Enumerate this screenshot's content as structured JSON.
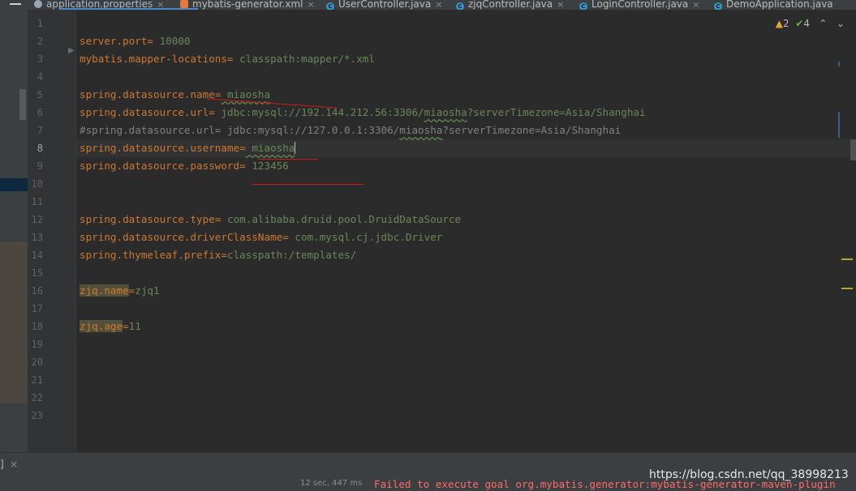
{
  "tabs": [
    {
      "label": "application.properties",
      "icon": "properties-file-icon",
      "active": true
    },
    {
      "label": "mybatis-generator.xml",
      "icon": "xml-file-icon"
    },
    {
      "label": "UserController.java",
      "icon": "java-class-icon"
    },
    {
      "label": "zjqController.java",
      "icon": "java-class-icon"
    },
    {
      "label": "LoginController.java",
      "icon": "java-class-icon"
    },
    {
      "label": "DemoApplication.java",
      "icon": "spring-app-icon"
    }
  ],
  "tab_close_glyph": "×",
  "inspection": {
    "warnings": "2",
    "ok": "4",
    "up": "^",
    "down": "v"
  },
  "line_numbers": [
    "1",
    "2",
    "3",
    "4",
    "5",
    "6",
    "7",
    "8",
    "9",
    "10",
    "11",
    "12",
    "13",
    "14",
    "15",
    "16",
    "17",
    "18",
    "19",
    "20",
    "21",
    "22",
    "23"
  ],
  "current_line": "8",
  "code": {
    "l2": {
      "key": "server.port",
      "eq": "=",
      "val": " 10000"
    },
    "l3": {
      "key": "mybatis.mapper-locations",
      "eq": "=",
      "val": " classpath:mapper/*.xml"
    },
    "l5": {
      "key": "spring.datasource.name",
      "eq": "=",
      "val": " miaosha"
    },
    "l6": {
      "key": "spring.datasource.url",
      "eq": "=",
      "val1": " jdbc:mysql://192.144.212.56:3306/",
      "typo": "miaosha",
      "val2": "?serverTimezone=Asia/Shanghai"
    },
    "l7": {
      "comment1": "#spring.datasource.url= jdbc:mysql://127.0.0.1:3306/",
      "typo": "miaosha",
      "comment2": "?serverTimezone=Asia/Shanghai"
    },
    "l8": {
      "key": "spring.datasource.username",
      "eq": "=",
      "val": " miaosha"
    },
    "l9": {
      "key": "spring.datasource.password",
      "eq": "=",
      "val": " 123456"
    },
    "l12": {
      "key": "spring.datasource.type",
      "eq": "=",
      "val": " com.alibaba.druid.pool.DruidDataSource"
    },
    "l13": {
      "key": "spring.datasource.driverClassName",
      "eq": "=",
      "val": " com.mysql.cj.jdbc.Driver"
    },
    "l14": {
      "key": "spring.thymeleaf.prefix",
      "eq": "=",
      "val": "classpath:/templates/"
    },
    "l16": {
      "key": "zjq.name",
      "eq": "=",
      "val": "zjq1"
    },
    "l18": {
      "key": "zjq.age",
      "eq": "=",
      "val": "11"
    }
  },
  "status": {
    "timing": "12 sec, 447 ms",
    "error": "Failed to execute goal org.mybatis.generator:mybatis-generator-maven-plugin",
    "watermark": "https://blog.csdn.net/qq_38998213",
    "bracket": "]"
  },
  "colors": {
    "key": "#cc7832",
    "value": "#6a8759",
    "comment": "#808080",
    "error": "#ff6b68",
    "background": "#2b2b2b"
  }
}
